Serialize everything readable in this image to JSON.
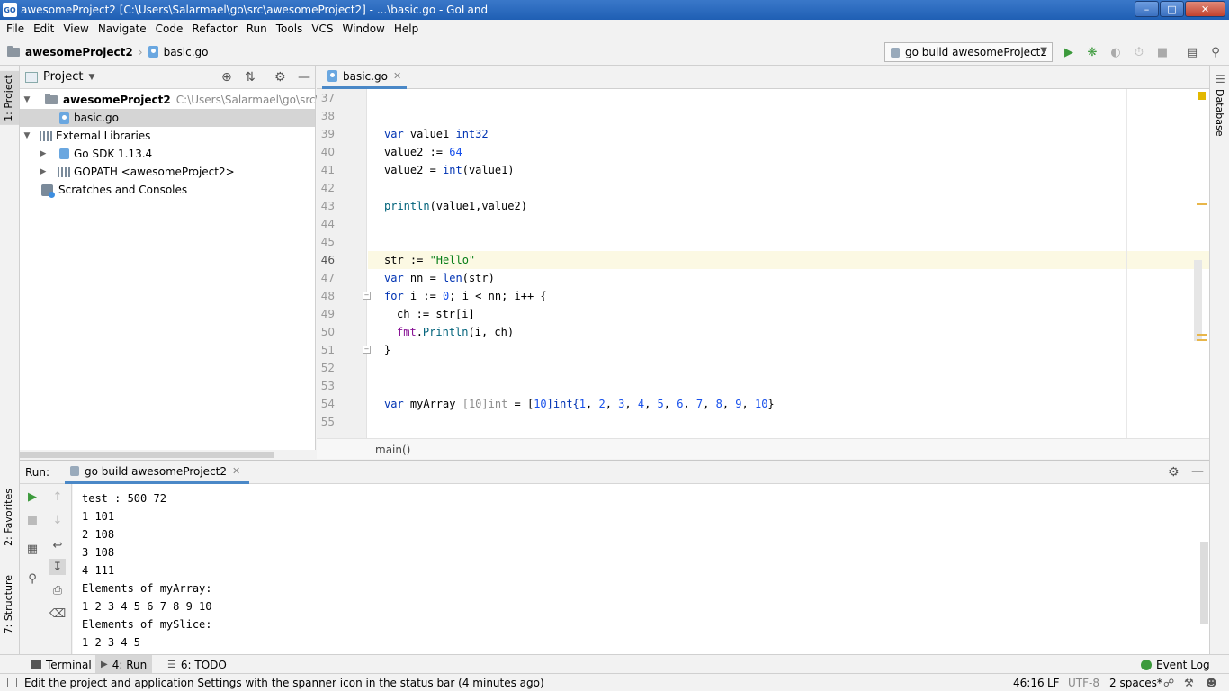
{
  "window": {
    "title": "awesomeProject2 [C:\\Users\\Salarmael\\go\\src\\awesomeProject2] - ...\\basic.go - GoLand",
    "logo_text": "GO"
  },
  "menu": [
    "File",
    "Edit",
    "View",
    "Navigate",
    "Code",
    "Refactor",
    "Run",
    "Tools",
    "VCS",
    "Window",
    "Help"
  ],
  "navbar": {
    "project": "awesomeProject2",
    "file": "basic.go",
    "run_config": "go build awesomeProject2"
  },
  "left_strip": {
    "project_tab": "1: Project",
    "favorites_tab": "2: Favorites",
    "structure_tab": "7: Structure"
  },
  "right_strip": {
    "database_tab": "Database"
  },
  "project_panel": {
    "title": "Project",
    "tree": {
      "root_name": "awesomeProject2",
      "root_path": "C:\\Users\\Salarmael\\go\\src\\awesom",
      "file": "basic.go",
      "external_libraries": "External Libraries",
      "go_sdk": "Go SDK 1.13.4",
      "gopath": "GOPATH <awesomeProject2>",
      "scratches": "Scratches and Consoles"
    }
  },
  "editor": {
    "tab": "basic.go",
    "line_numbers": [
      "37",
      "38",
      "39",
      "40",
      "41",
      "42",
      "43",
      "44",
      "45",
      "46",
      "47",
      "48",
      "49",
      "50",
      "51",
      "52",
      "53",
      "54",
      "55"
    ],
    "breadcrumb": "main()",
    "code": {
      "l39": {
        "kw": "var",
        "rest": " value1 ",
        "type": "int32"
      },
      "l40": {
        "text": "value2 := ",
        "num": "64"
      },
      "l41": {
        "text": "value2 = ",
        "fn": "int",
        "rest": "(value1)"
      },
      "l43": {
        "fn": "println",
        "rest": "(value1,value2)"
      },
      "l46": {
        "text": "str := ",
        "str": "\"Hello\""
      },
      "l47": {
        "kw": "var",
        "text": " nn = ",
        "fn": "len",
        "rest": "(str)"
      },
      "l48": {
        "kw": "for",
        "text1": " i := ",
        "num": "0",
        "text2": "; i < nn; i++ {"
      },
      "l49": {
        "text": "ch := str[i]"
      },
      "l50": {
        "pkg": "fmt",
        "dot": ".",
        "fn": "Println",
        "rest": "(i, ch)"
      },
      "l51": {
        "text": "}"
      },
      "l54": {
        "kw": "var",
        "text": " myArray ",
        "dim": "[10]int",
        "eq": " = [",
        "n10": "10",
        "rb": "]int{",
        "vals": [
          "1",
          "2",
          "3",
          "4",
          "5",
          "6",
          "7",
          "8",
          "9",
          "10"
        ],
        "close": "}"
      }
    }
  },
  "run_panel": {
    "label": "Run:",
    "tab": "go build awesomeProject2",
    "output": [
      "test : 500 72",
      "1 101",
      "2 108",
      "3 108",
      "4 111",
      "Elements of myArray:",
      "1 2 3 4 5 6 7 8 9 10",
      "Elements of mySlice:",
      "1 2 3 4 5"
    ]
  },
  "bottom_tabs": {
    "terminal": "Terminal",
    "run": "4: Run",
    "todo": "6: TODO",
    "event_log": "Event Log"
  },
  "status": {
    "message": "Edit the project and application Settings with the spanner icon in the status bar (4 minutes ago)",
    "position": "46:16",
    "line_sep": "LF",
    "encoding": "UTF-8",
    "indent": "2 spaces*"
  },
  "colors": {
    "accent": "#4a88c7",
    "keyword": "#0033b3",
    "number": "#1750eb",
    "string": "#067d17",
    "run_green": "#3c9a3c"
  }
}
